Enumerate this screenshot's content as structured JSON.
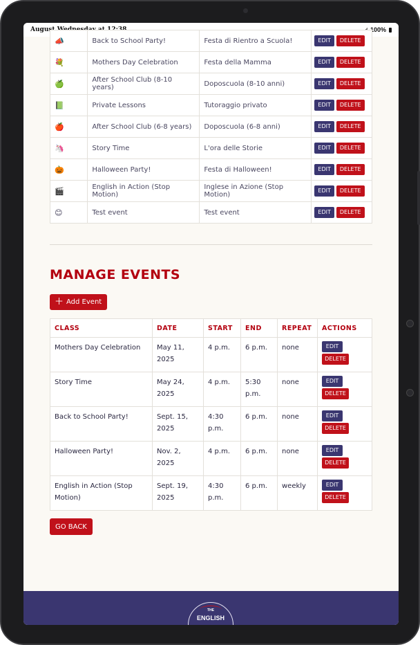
{
  "status": {
    "time": "August Wednesday at 12:38",
    "battery": "100%"
  },
  "classes": [
    {
      "icon": "📣",
      "en": "Back to School Party!",
      "it": "Festa di Rientro a Scuola!"
    },
    {
      "icon": "💐",
      "en": "Mothers Day Celebration",
      "it": "Festa della Mamma"
    },
    {
      "icon": "🍏",
      "en": "After School Club (8-10 years)",
      "it": "Doposcuola (8-10 anni)"
    },
    {
      "icon": "📗",
      "en": "Private Lessons",
      "it": "Tutoraggio privato"
    },
    {
      "icon": "🍎",
      "en": "After School Club (6-8 years)",
      "it": "Doposcuola (6-8 anni)"
    },
    {
      "icon": "🦄",
      "en": "Story Time",
      "it": "L'ora delle Storie"
    },
    {
      "icon": "🎃",
      "en": "Halloween Party!",
      "it": "Festa di Halloween!"
    },
    {
      "icon": "🎬",
      "en": "English in Action (Stop Motion)",
      "it": "Inglese in Azione (Stop Motion)"
    },
    {
      "icon": "😊",
      "en": "Test event",
      "it": "Test event"
    }
  ],
  "buttons": {
    "edit": "EDIT",
    "delete": "DELETE",
    "add_event": "Add Event",
    "go_back": "GO BACK"
  },
  "manage": {
    "title": "MANAGE EVENTS",
    "headers": {
      "class": "CLASS",
      "date": "DATE",
      "start": "START",
      "end": "END",
      "repeat": "REPEAT",
      "actions": "ACTIONS"
    },
    "events": [
      {
        "class": "Mothers Day Celebration",
        "date": "May 11, 2025",
        "start": "4 p.m.",
        "end": "6 p.m.",
        "repeat": "none"
      },
      {
        "class": "Story Time",
        "date": "May 24, 2025",
        "start": "4 p.m.",
        "end": "5:30 p.m.",
        "repeat": "none"
      },
      {
        "class": "Back to School Party!",
        "date": "Sept. 15, 2025",
        "start": "4:30 p.m.",
        "end": "6 p.m.",
        "repeat": "none"
      },
      {
        "class": "Halloween Party!",
        "date": "Nov. 2, 2025",
        "start": "4 p.m.",
        "end": "6 p.m.",
        "repeat": "none"
      },
      {
        "class": "English in Action (Stop Motion)",
        "date": "Sept. 19, 2025",
        "start": "4:30 p.m.",
        "end": "6 p.m.",
        "repeat": "weekly"
      }
    ]
  },
  "footer": {
    "logo_top": "THE",
    "logo_main": "ENGLISH"
  }
}
